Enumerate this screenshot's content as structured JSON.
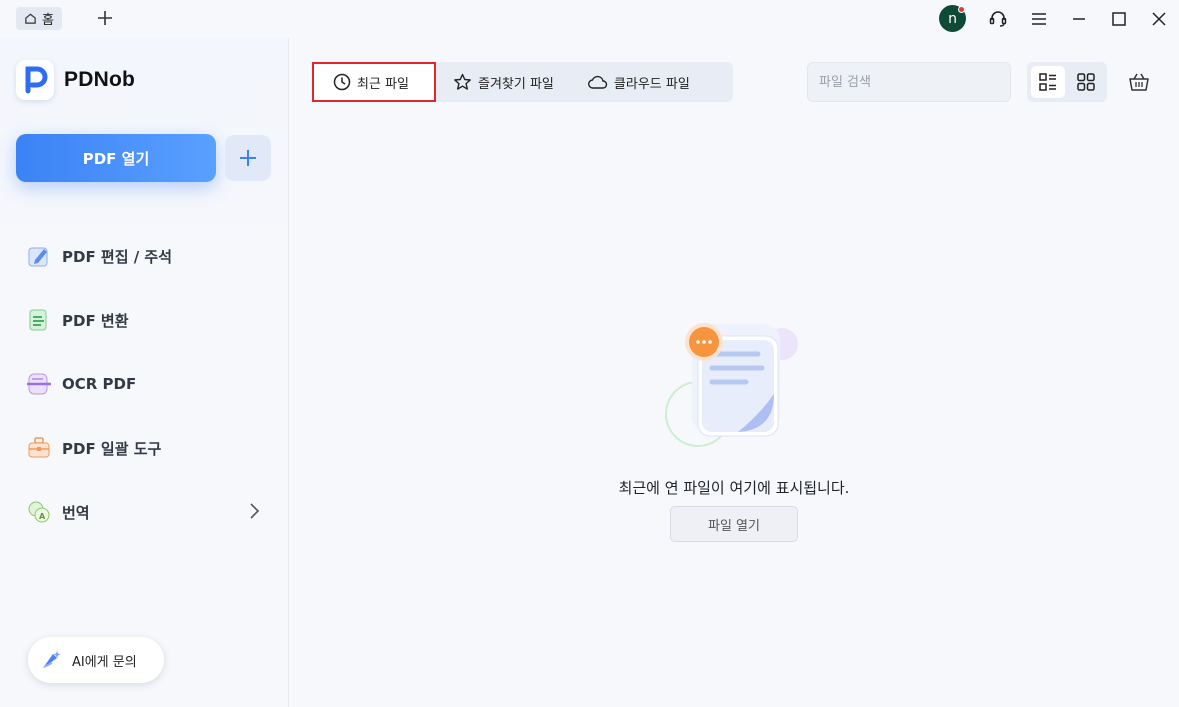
{
  "titlebar": {
    "home_tab_label": "홈",
    "avatar_letter": "n"
  },
  "sidebar": {
    "app_name": "PDNob",
    "open_button_label": "PDF 열기",
    "items": [
      {
        "label": "PDF 편집 / 주석",
        "icon": "edit-icon"
      },
      {
        "label": "PDF 변환",
        "icon": "convert-icon"
      },
      {
        "label": "OCR PDF",
        "icon": "ocr-icon"
      },
      {
        "label": "PDF 일괄 도구",
        "icon": "toolbox-icon"
      },
      {
        "label": "번역",
        "icon": "translate-icon"
      }
    ],
    "ai_button_label": "AI에게 문의"
  },
  "main": {
    "tabs": [
      {
        "label": "최근 파일",
        "icon": "clock-icon",
        "active": true
      },
      {
        "label": "즐겨찾기 파일",
        "icon": "star-icon",
        "active": false
      },
      {
        "label": "클라우드 파일",
        "icon": "cloud-icon",
        "active": false
      }
    ],
    "search_placeholder": "파일 검색",
    "empty_message": "최근에 연 파일이 여기에 표시됩니다.",
    "empty_open_button": "파일 열기"
  },
  "colors": {
    "accent": "#3b82f6",
    "active_tab_border": "#e0262f",
    "avatar_bg": "#0e4a36"
  }
}
